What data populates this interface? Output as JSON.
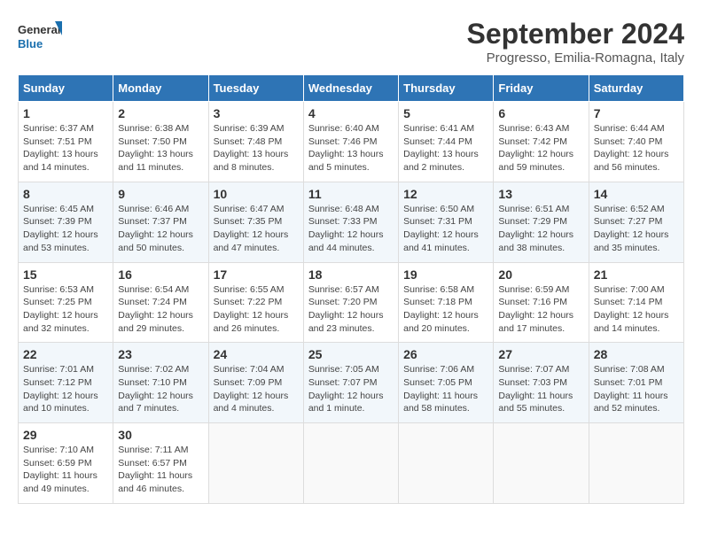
{
  "logo": {
    "line1": "General",
    "line2": "Blue"
  },
  "title": "September 2024",
  "subtitle": "Progresso, Emilia-Romagna, Italy",
  "weekdays": [
    "Sunday",
    "Monday",
    "Tuesday",
    "Wednesday",
    "Thursday",
    "Friday",
    "Saturday"
  ],
  "weeks": [
    [
      {
        "day": "1",
        "info": "Sunrise: 6:37 AM\nSunset: 7:51 PM\nDaylight: 13 hours\nand 14 minutes."
      },
      {
        "day": "2",
        "info": "Sunrise: 6:38 AM\nSunset: 7:50 PM\nDaylight: 13 hours\nand 11 minutes."
      },
      {
        "day": "3",
        "info": "Sunrise: 6:39 AM\nSunset: 7:48 PM\nDaylight: 13 hours\nand 8 minutes."
      },
      {
        "day": "4",
        "info": "Sunrise: 6:40 AM\nSunset: 7:46 PM\nDaylight: 13 hours\nand 5 minutes."
      },
      {
        "day": "5",
        "info": "Sunrise: 6:41 AM\nSunset: 7:44 PM\nDaylight: 13 hours\nand 2 minutes."
      },
      {
        "day": "6",
        "info": "Sunrise: 6:43 AM\nSunset: 7:42 PM\nDaylight: 12 hours\nand 59 minutes."
      },
      {
        "day": "7",
        "info": "Sunrise: 6:44 AM\nSunset: 7:40 PM\nDaylight: 12 hours\nand 56 minutes."
      }
    ],
    [
      {
        "day": "8",
        "info": "Sunrise: 6:45 AM\nSunset: 7:39 PM\nDaylight: 12 hours\nand 53 minutes."
      },
      {
        "day": "9",
        "info": "Sunrise: 6:46 AM\nSunset: 7:37 PM\nDaylight: 12 hours\nand 50 minutes."
      },
      {
        "day": "10",
        "info": "Sunrise: 6:47 AM\nSunset: 7:35 PM\nDaylight: 12 hours\nand 47 minutes."
      },
      {
        "day": "11",
        "info": "Sunrise: 6:48 AM\nSunset: 7:33 PM\nDaylight: 12 hours\nand 44 minutes."
      },
      {
        "day": "12",
        "info": "Sunrise: 6:50 AM\nSunset: 7:31 PM\nDaylight: 12 hours\nand 41 minutes."
      },
      {
        "day": "13",
        "info": "Sunrise: 6:51 AM\nSunset: 7:29 PM\nDaylight: 12 hours\nand 38 minutes."
      },
      {
        "day": "14",
        "info": "Sunrise: 6:52 AM\nSunset: 7:27 PM\nDaylight: 12 hours\nand 35 minutes."
      }
    ],
    [
      {
        "day": "15",
        "info": "Sunrise: 6:53 AM\nSunset: 7:25 PM\nDaylight: 12 hours\nand 32 minutes."
      },
      {
        "day": "16",
        "info": "Sunrise: 6:54 AM\nSunset: 7:24 PM\nDaylight: 12 hours\nand 29 minutes."
      },
      {
        "day": "17",
        "info": "Sunrise: 6:55 AM\nSunset: 7:22 PM\nDaylight: 12 hours\nand 26 minutes."
      },
      {
        "day": "18",
        "info": "Sunrise: 6:57 AM\nSunset: 7:20 PM\nDaylight: 12 hours\nand 23 minutes."
      },
      {
        "day": "19",
        "info": "Sunrise: 6:58 AM\nSunset: 7:18 PM\nDaylight: 12 hours\nand 20 minutes."
      },
      {
        "day": "20",
        "info": "Sunrise: 6:59 AM\nSunset: 7:16 PM\nDaylight: 12 hours\nand 17 minutes."
      },
      {
        "day": "21",
        "info": "Sunrise: 7:00 AM\nSunset: 7:14 PM\nDaylight: 12 hours\nand 14 minutes."
      }
    ],
    [
      {
        "day": "22",
        "info": "Sunrise: 7:01 AM\nSunset: 7:12 PM\nDaylight: 12 hours\nand 10 minutes."
      },
      {
        "day": "23",
        "info": "Sunrise: 7:02 AM\nSunset: 7:10 PM\nDaylight: 12 hours\nand 7 minutes."
      },
      {
        "day": "24",
        "info": "Sunrise: 7:04 AM\nSunset: 7:09 PM\nDaylight: 12 hours\nand 4 minutes."
      },
      {
        "day": "25",
        "info": "Sunrise: 7:05 AM\nSunset: 7:07 PM\nDaylight: 12 hours\nand 1 minute."
      },
      {
        "day": "26",
        "info": "Sunrise: 7:06 AM\nSunset: 7:05 PM\nDaylight: 11 hours\nand 58 minutes."
      },
      {
        "day": "27",
        "info": "Sunrise: 7:07 AM\nSunset: 7:03 PM\nDaylight: 11 hours\nand 55 minutes."
      },
      {
        "day": "28",
        "info": "Sunrise: 7:08 AM\nSunset: 7:01 PM\nDaylight: 11 hours\nand 52 minutes."
      }
    ],
    [
      {
        "day": "29",
        "info": "Sunrise: 7:10 AM\nSunset: 6:59 PM\nDaylight: 11 hours\nand 49 minutes."
      },
      {
        "day": "30",
        "info": "Sunrise: 7:11 AM\nSunset: 6:57 PM\nDaylight: 11 hours\nand 46 minutes."
      },
      {
        "day": "",
        "info": ""
      },
      {
        "day": "",
        "info": ""
      },
      {
        "day": "",
        "info": ""
      },
      {
        "day": "",
        "info": ""
      },
      {
        "day": "",
        "info": ""
      }
    ]
  ]
}
